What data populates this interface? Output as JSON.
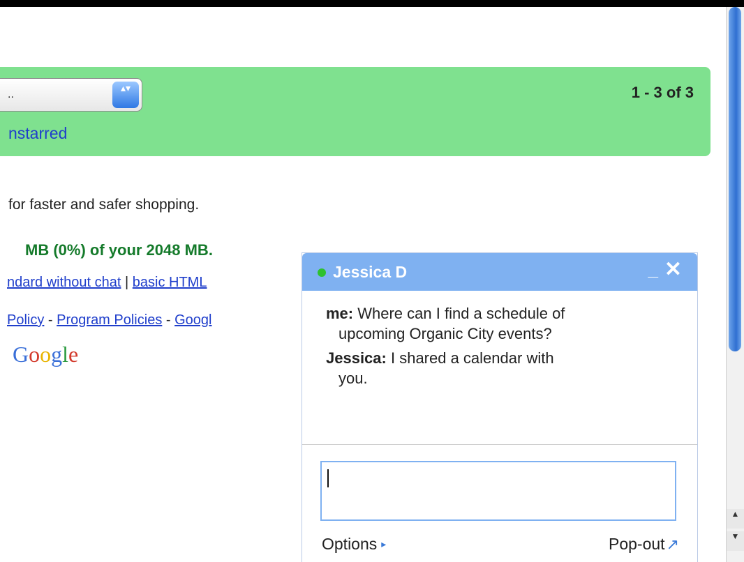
{
  "toolbar": {
    "select_value": "..",
    "stepper_glyph": "▴▾",
    "unstarred_label": "nstarred",
    "pager_text": "1 - 3 of 3"
  },
  "content": {
    "promo_text": "for faster and safer shopping.",
    "storage_text": "MB (0%) of your 2048 MB.",
    "view_links": [
      "ndard without chat",
      "basic HTML"
    ],
    "view_separator": "|",
    "policy_links": [
      "Policy",
      "Program Policies",
      "Googl"
    ],
    "policy_separator": "-",
    "google_letters": [
      "G",
      "o",
      "o",
      "g",
      "l",
      "e"
    ]
  },
  "chat": {
    "contact_name": "Jessica D",
    "status_color": "#2ec12e",
    "minimize_glyph": "_",
    "close_glyph": "✕",
    "messages": [
      {
        "sender": "me:",
        "text": "Where can I find a schedule of",
        "continuation": "upcoming Organic City events?"
      },
      {
        "sender": "Jessica:",
        "text": "I shared a calendar with",
        "continuation": "you."
      }
    ],
    "input_value": "",
    "options_label": "Options",
    "options_arrow": "▸",
    "popout_label": "Pop-out",
    "popout_arrow": "↗"
  },
  "scrollbar": {
    "up_arrow": "▲",
    "down_arrow": "▼"
  },
  "colors": {
    "toolbar_bg": "#7fe18f",
    "chat_header": "#7fb1f1",
    "link": "#1f3ecb",
    "storage_text": "#147a2a"
  }
}
